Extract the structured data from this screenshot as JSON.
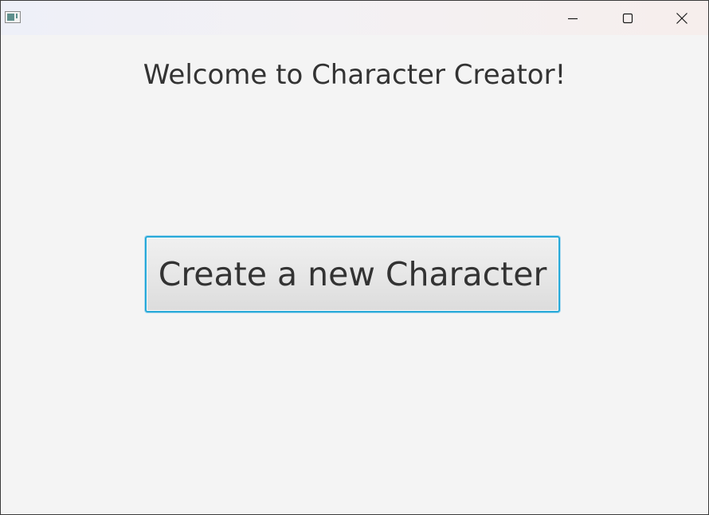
{
  "window": {
    "title": "",
    "controls": {
      "minimize": "minimize-icon",
      "maximize": "maximize-icon",
      "close": "close-icon"
    }
  },
  "main": {
    "heading": "Welcome to Character Creator!",
    "create_button_label": "Create a new Character"
  },
  "colors": {
    "background": "#f4f4f4",
    "text": "#333333",
    "focus_border": "#27a9d8",
    "app_icon": "#5e8f8c"
  }
}
